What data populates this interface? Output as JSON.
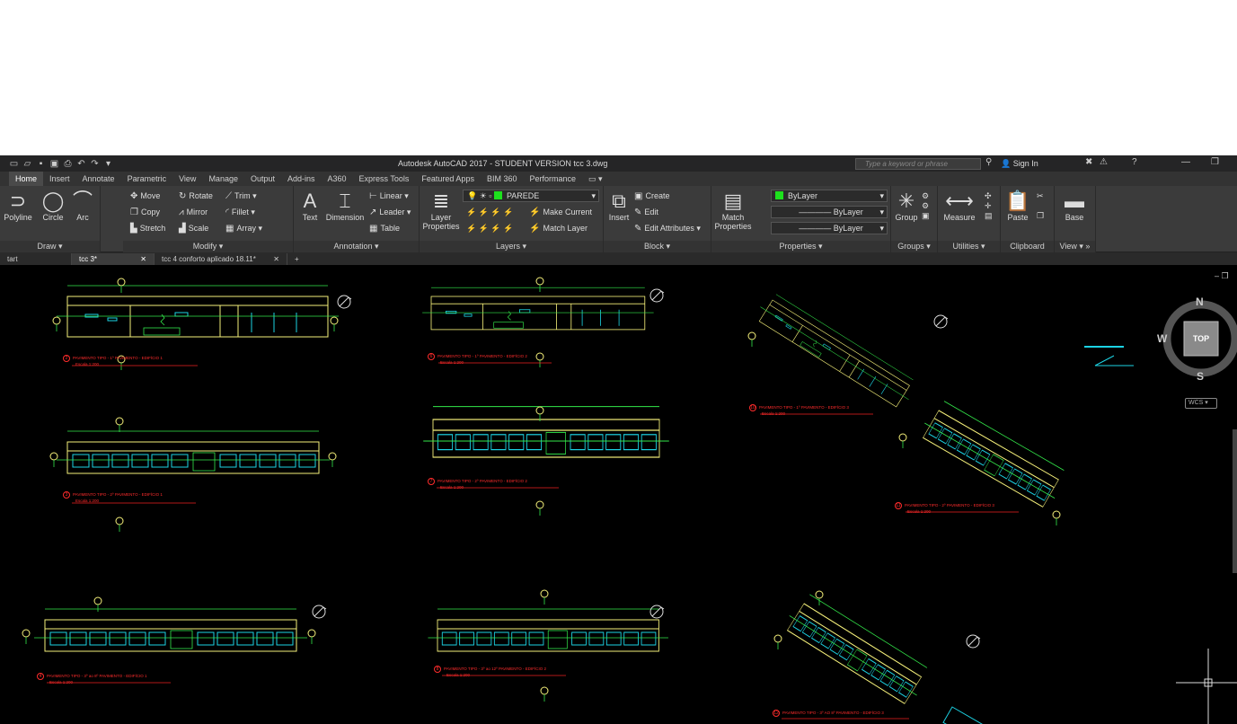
{
  "title_bar": {
    "app_title": "Autodesk AutoCAD 2017 - STUDENT VERSION    tcc 3.dwg",
    "search_placeholder": "Type a keyword or phrase",
    "sign_in": "Sign In"
  },
  "ribbon_tabs": [
    "Home",
    "Insert",
    "Annotate",
    "Parametric",
    "View",
    "Manage",
    "Output",
    "Add-ins",
    "A360",
    "Express Tools",
    "Featured Apps",
    "BIM 360",
    "Performance"
  ],
  "draw": {
    "polyline": "Polyline",
    "circle": "Circle",
    "arc": "Arc",
    "title": "Draw"
  },
  "modify": {
    "move": "Move",
    "rotate": "Rotate",
    "trim": "Trim",
    "copy": "Copy",
    "mirror": "Mirror",
    "fillet": "Fillet",
    "stretch": "Stretch",
    "scale": "Scale",
    "array": "Array",
    "title": "Modify"
  },
  "annotation": {
    "text": "Text",
    "dimension": "Dimension",
    "linear": "Linear",
    "leader": "Leader",
    "table": "Table",
    "title": "Annotation"
  },
  "layers": {
    "layer_properties": "Layer Properties",
    "current_layer": "PAREDE",
    "make_current": "Make Current",
    "match_layer": "Match Layer",
    "title": "Layers"
  },
  "block": {
    "insert": "Insert",
    "create": "Create",
    "edit": "Edit",
    "edit_attributes": "Edit Attributes",
    "title": "Block"
  },
  "properties": {
    "match_properties": "Match Properties",
    "color": "ByLayer",
    "linetype": "ByLayer",
    "lineweight": "ByLayer",
    "title": "Properties"
  },
  "groups": {
    "group": "Group",
    "title": "Groups"
  },
  "utilities": {
    "measure": "Measure",
    "title": "Utilities"
  },
  "clipboard": {
    "paste": "Paste",
    "title": "Clipboard"
  },
  "view": {
    "base": "Base",
    "title": "View"
  },
  "doc_tabs": [
    "tart",
    "tcc 3*",
    "tcc 4 conforto aplicado 18.11*"
  ],
  "viewcube": {
    "north": "N",
    "south": "S",
    "west": "W",
    "top": "TOP",
    "wcs": "WCS"
  },
  "drawings": {
    "cap1": {
      "num": "2",
      "title": "PAVIMENTO TIPO - 1º PAVIMENTO - EDIFÍCIO 1",
      "scale": "Escala 1:200"
    },
    "cap2": {
      "num": "6",
      "title": "PAVIMENTO TIPO - 1º PAVIMENTO - EDIFÍCIO 2",
      "scale": "Escala 1:200"
    },
    "cap3": {
      "num": "10",
      "title": "PAVIMENTO TIPO - 1º PAVIMENTO - EDIFÍCIO 3",
      "scale": "Escala 1:200"
    },
    "cap4": {
      "num": "3",
      "title": "PAVIMENTO TIPO - 2º PAVIMENTO - EDIFÍCIO 1",
      "scale": "Escala 1:200"
    },
    "cap5": {
      "num": "7",
      "title": "PAVIMENTO TIPO - 2º PAVIMENTO - EDIFÍCIO 2",
      "scale": "Escala 1:200"
    },
    "cap6": {
      "num": "11",
      "title": "PAVIMENTO TIPO - 2º PAVIMENTO - EDIFÍCIO 3",
      "scale": "Escala 1:200"
    },
    "cap7": {
      "num": "4",
      "title": "PAVIMENTO TIPO - 3º ao 8º PAVIMENTO - EDIFÍCIO 1",
      "scale": "Escala 1:200"
    },
    "cap8": {
      "num": "8",
      "title": "PAVIMENTO TIPO - 3º ao 12º PAVIMENTO - EDIFÍCIO 2",
      "scale": "Escala 1:200"
    },
    "cap9": {
      "num": "12",
      "title": "PAVIMENTO TIPO - 3º AO 8º PAVIMENTO - EDIFÍCIO 3",
      "scale": ""
    }
  }
}
